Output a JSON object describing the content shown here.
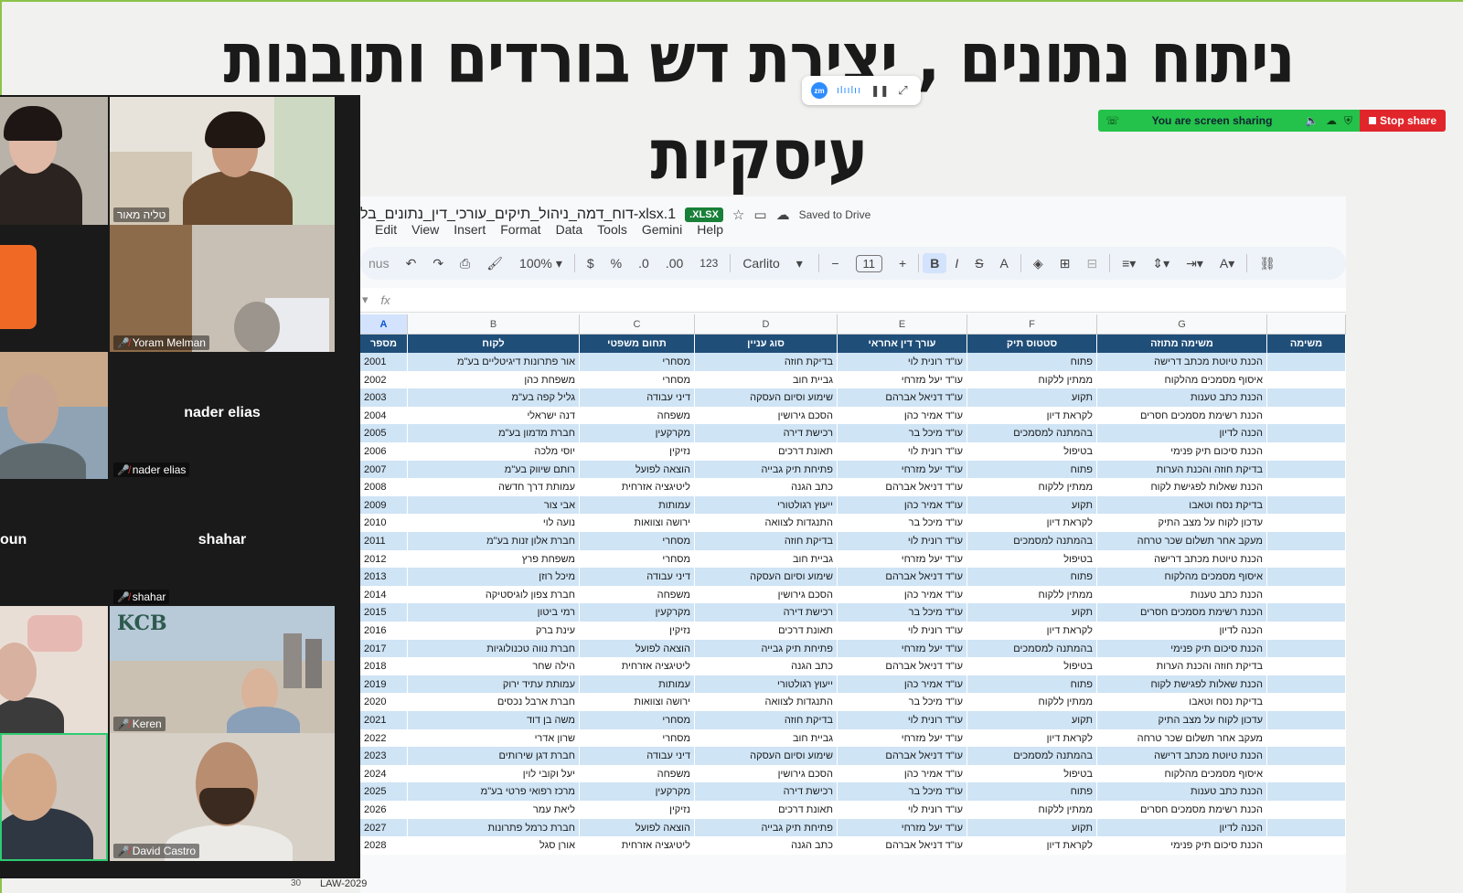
{
  "slide": {
    "title": "ניתוח נתונים , יצירת דש בורדים ותובנות עיסקיות"
  },
  "zoom_controls": {
    "logo": "zm",
    "wave": "ılıılıı",
    "pause": "❚❚",
    "expand": "⤢"
  },
  "share_bar": {
    "status": "You are screen sharing",
    "stop_label": "Stop share"
  },
  "gallery": {
    "participants": [
      {
        "name": "",
        "muted": false
      },
      {
        "name": "טליה מאור",
        "muted": false
      },
      {
        "name": "",
        "muted": false
      },
      {
        "name": "Yoram Melman",
        "muted": true
      },
      {
        "name": "",
        "muted": false
      },
      {
        "name": "nader elias",
        "muted": true,
        "center_label": "nader elias"
      },
      {
        "name": "",
        "muted": false,
        "center_label": "oun"
      },
      {
        "name": "shahar",
        "muted": true,
        "center_label": "shahar"
      },
      {
        "name": "",
        "muted": false
      },
      {
        "name": "Keren",
        "muted": true,
        "logo_text": "KCB"
      },
      {
        "name": "",
        "muted": false
      },
      {
        "name": "David Castro",
        "muted": true
      }
    ]
  },
  "sheets": {
    "doc_name": "דוח_דמה_ניהול_תיקים_עורכי_דין_נתונים_בל-xlsx.1",
    "format_badge": ".XLSX",
    "saved_label": "Saved to Drive",
    "menu": [
      "Edit",
      "View",
      "Insert",
      "Format",
      "Data",
      "Tools",
      "Gemini",
      "Help"
    ],
    "toolbar": {
      "zoom_partial": "nus",
      "zoom": "100%",
      "currency": "$",
      "percent": "%",
      "dec_less": ".0",
      "dec_more": ".00",
      "num_format": "123",
      "font": "Carlito",
      "font_size": "11",
      "bold": "B",
      "italic": "I",
      "strike": "S",
      "text_color": "A"
    },
    "fx_label": "fx",
    "columns": [
      "A",
      "B",
      "C",
      "D",
      "E",
      "F",
      "G"
    ],
    "header_row": [
      "מספר",
      "לקוח",
      "תחום משפטי",
      "סוג עניין",
      "עורך דין אחראי",
      "סטטוס תיק",
      "משימה מתוזה",
      "משימה"
    ],
    "rows": [
      [
        "2001",
        "אור פתרונות דיגיטליים בע\"מ",
        "מסחרי",
        "בדיקת חוזה",
        "עו\"ד רונית לוי",
        "פתוח",
        "הכנת טיוטת מכתב דרישה"
      ],
      [
        "2002",
        "משפחת כהן",
        "מסחרי",
        "גביית חוב",
        "עו\"ד יעל מזרחי",
        "ממתין ללקוח",
        "איסוף מסמכים מהלקוח"
      ],
      [
        "2003",
        "גליל קפה בע\"מ",
        "דיני עבודה",
        "שימוע וסיום העסקה",
        "עו\"ד דניאל אברהם",
        "תקוע",
        "הכנת כתב טענות"
      ],
      [
        "2004",
        "דנה ישראלי",
        "משפחה",
        "הסכם גירושין",
        "עו\"ד אמיר כהן",
        "לקראת דיון",
        "הכנת רשימת מסמכים חסרים"
      ],
      [
        "2005",
        "חברת מדמון בע\"מ",
        "מקרקעין",
        "רכישת דירה",
        "עו\"ד מיכל בר",
        "בהמתנה למסמכים",
        "הכנה לדיון"
      ],
      [
        "2006",
        "יוסי מלכה",
        "נזיקין",
        "תאונת דרכים",
        "עו\"ד רונית לוי",
        "בטיפול",
        "הכנת סיכום תיק פנימי"
      ],
      [
        "2007",
        "רותם שיווק בע\"מ",
        "הוצאה לפועל",
        "פתיחת תיק גבייה",
        "עו\"ד יעל מזרחי",
        "פתוח",
        "בדיקת חוזה והכנת הערות"
      ],
      [
        "2008",
        "עמותת דרך חדשה",
        "ליטיגציה אזרחית",
        "כתב הגנה",
        "עו\"ד דניאל אברהם",
        "ממתין ללקוח",
        "הכנת שאלות לפגישת לקוח"
      ],
      [
        "2009",
        "אבי צור",
        "עמותות",
        "ייעוץ רגולטורי",
        "עו\"ד אמיר כהן",
        "תקוע",
        "בדיקת נסח וטאבו"
      ],
      [
        "2010",
        "נועה לוי",
        "ירושה וצוואות",
        "התנגדות לצוואה",
        "עו\"ד מיכל בר",
        "לקראת דיון",
        "עדכון לקוח על מצב התיק"
      ],
      [
        "2011",
        "חברת אלון זנות בע\"מ",
        "מסחרי",
        "בדיקת חוזה",
        "עו\"ד רונית לוי",
        "בהמתנה למסמכים",
        "מעקב אחר תשלום שכר טרחה"
      ],
      [
        "2012",
        "משפחת פרץ",
        "מסחרי",
        "גביית חוב",
        "עו\"ד יעל מזרחי",
        "בטיפול",
        "הכנת טיוטת מכתב דרישה"
      ],
      [
        "2013",
        "מיכל רוזן",
        "דיני עבודה",
        "שימוע וסיום העסקה",
        "עו\"ד דניאל אברהם",
        "פתוח",
        "איסוף מסמכים מהלקוח"
      ],
      [
        "2014",
        "חברת צפון לוגיסטיקה",
        "משפחה",
        "הסכם גירושין",
        "עו\"ד אמיר כהן",
        "ממתין ללקוח",
        "הכנת כתב טענות"
      ],
      [
        "2015",
        "רמי ביטון",
        "מקרקעין",
        "רכישת דירה",
        "עו\"ד מיכל בר",
        "תקוע",
        "הכנת רשימת מסמכים חסרים"
      ],
      [
        "2016",
        "עינת ברק",
        "נזיקין",
        "תאונת דרכים",
        "עו\"ד רונית לוי",
        "לקראת דיון",
        "הכנה לדיון"
      ],
      [
        "2017",
        "חברת נווה טכנולוגיות",
        "הוצאה לפועל",
        "פתיחת תיק גבייה",
        "עו\"ד יעל מזרחי",
        "בהמתנה למסמכים",
        "הכנת סיכום תיק פנימי"
      ],
      [
        "2018",
        "הילה שחר",
        "ליטיגציה אזרחית",
        "כתב הגנה",
        "עו\"ד דניאל אברהם",
        "בטיפול",
        "בדיקת חוזה והכנת הערות"
      ],
      [
        "2019",
        "עמותת עתיד ירוק",
        "עמותות",
        "ייעוץ רגולטורי",
        "עו\"ד אמיר כהן",
        "פתוח",
        "הכנת שאלות לפגישת לקוח"
      ],
      [
        "2020",
        "חברת ארבל נכסים",
        "ירושה וצוואות",
        "התנגדות לצוואה",
        "עו\"ד מיכל בר",
        "ממתין ללקוח",
        "בדיקת נסח וטאבו"
      ],
      [
        "2021",
        "משה בן דוד",
        "מסחרי",
        "בדיקת חוזה",
        "עו\"ד רונית לוי",
        "תקוע",
        "עדכון לקוח על מצב התיק"
      ],
      [
        "2022",
        "שרון אדרי",
        "מסחרי",
        "גביית חוב",
        "עו\"ד יעל מזרחי",
        "לקראת דיון",
        "מעקב אחר תשלום שכר טרחה"
      ],
      [
        "2023",
        "חברת דגן שירותים",
        "דיני עבודה",
        "שימוע וסיום העסקה",
        "עו\"ד דניאל אברהם",
        "בהמתנה למסמכים",
        "הכנת טיוטת מכתב דרישה"
      ],
      [
        "2024",
        "יעל וקובי לוין",
        "משפחה",
        "הסכם גירושין",
        "עו\"ד אמיר כהן",
        "בטיפול",
        "איסוף מסמכים מהלקוח"
      ],
      [
        "2025",
        "מרכז רפואי פרטי בע\"מ",
        "מקרקעין",
        "רכישת דירה",
        "עו\"ד מיכל בר",
        "פתוח",
        "הכנת כתב טענות"
      ],
      [
        "2026",
        "ליאת עמר",
        "נזיקין",
        "תאונת דרכים",
        "עו\"ד רונית לוי",
        "ממתין ללקוח",
        "הכנת רשימת מסמכים חסרים"
      ],
      [
        "2027",
        "חברת כרמל פתרונות",
        "הוצאה לפועל",
        "פתיחת תיק גבייה",
        "עו\"ד יעל מזרחי",
        "תקוע",
        "הכנה לדיון"
      ],
      [
        "2028",
        "אורן סגל",
        "ליטיגציה אזרחית",
        "כתב הגנה",
        "עו\"ד דניאל אברהם",
        "לקראת דיון",
        "הכנת סיכום תיק פנימי"
      ]
    ],
    "bottom_row_number": "30",
    "bottom_row_id": "LAW-2029"
  },
  "colors": {
    "header_fill": "#1f4e79",
    "band_fill": "#cfe4f5",
    "share_green": "#24c24a",
    "stop_red": "#e0262b"
  }
}
